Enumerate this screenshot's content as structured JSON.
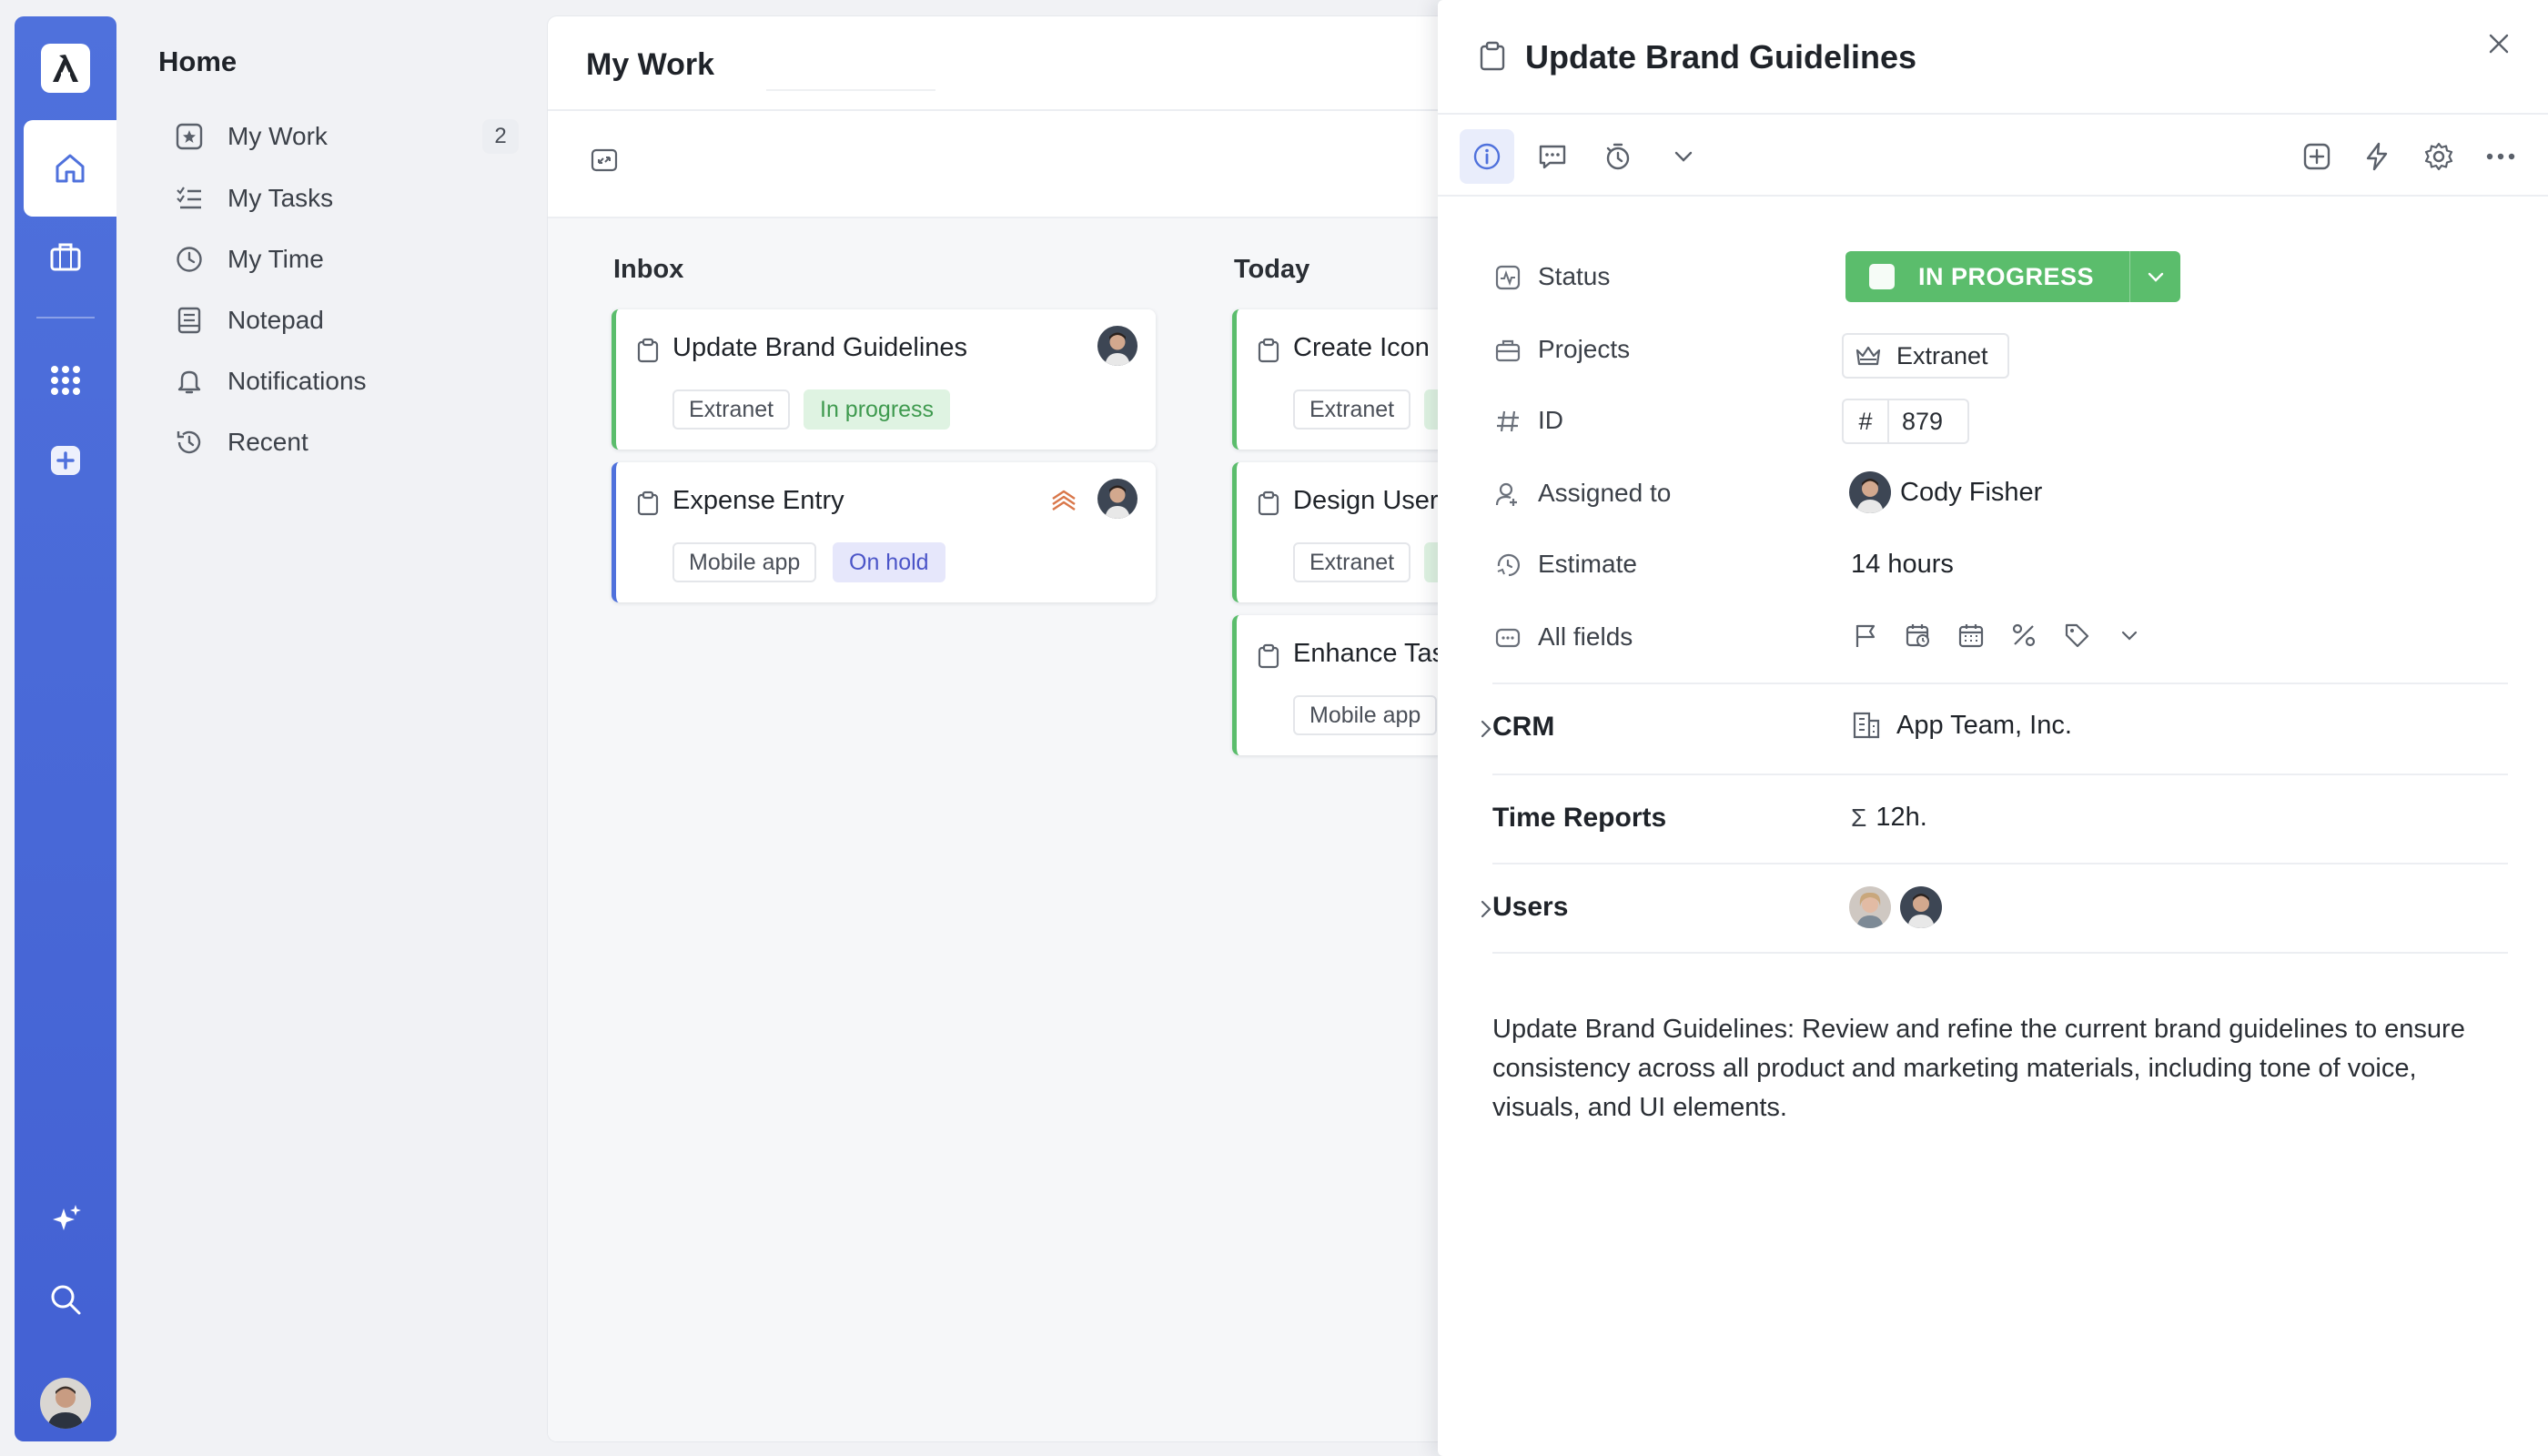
{
  "nav": {
    "title": "Home",
    "items": [
      {
        "label": "My Work",
        "icon": "star-box-icon",
        "badge": "2"
      },
      {
        "label": "My Tasks",
        "icon": "checklist-icon"
      },
      {
        "label": "My Time",
        "icon": "clock-icon"
      },
      {
        "label": "Notepad",
        "icon": "notepad-icon"
      },
      {
        "label": "Notifications",
        "icon": "bell-icon"
      },
      {
        "label": "Recent",
        "icon": "history-icon"
      }
    ]
  },
  "board": {
    "title": "My Work",
    "columns": [
      {
        "title": "Inbox",
        "cards": [
          {
            "title": "Update Brand Guidelines",
            "tags": [
              "Extranet",
              "In progress"
            ]
          },
          {
            "title": "Expense Entry",
            "tags": [
              "Mobile app",
              "On hold"
            ]
          }
        ]
      },
      {
        "title": "Today",
        "cards": [
          {
            "title": "Create Icon",
            "tags": [
              "Extranet"
            ]
          },
          {
            "title": "Design User",
            "tags": [
              "Extranet"
            ]
          },
          {
            "title": "Enhance Tas",
            "tags": [
              "Mobile app"
            ]
          }
        ]
      }
    ]
  },
  "panel": {
    "title": "Update Brand Guidelines",
    "fields": {
      "status_label": "Status",
      "status_value": "IN PROGRESS",
      "projects_label": "Projects",
      "projects_value": "Extranet",
      "id_label": "ID",
      "id_hash": "#",
      "id_value": "879",
      "assigned_label": "Assigned to",
      "assigned_value": "Cody Fisher",
      "estimate_label": "Estimate",
      "estimate_value": "14 hours",
      "allfields_label": "All fields"
    },
    "sections": {
      "crm_label": "CRM",
      "crm_value": "App Team, Inc.",
      "time_label": "Time Reports",
      "time_sigma": "Σ",
      "time_value": "12h.",
      "users_label": "Users"
    },
    "description": "Update Brand Guidelines: Review and refine the current brand guidelines to ensure consistency across all product and marketing materials, including tone of voice, visuals, and UI elements."
  },
  "colors": {
    "rail": "#4f71dc",
    "status_green": "#5bbd6c",
    "tag_green_bg": "#dff3e2",
    "tag_purple_bg": "#e6e7fb"
  }
}
